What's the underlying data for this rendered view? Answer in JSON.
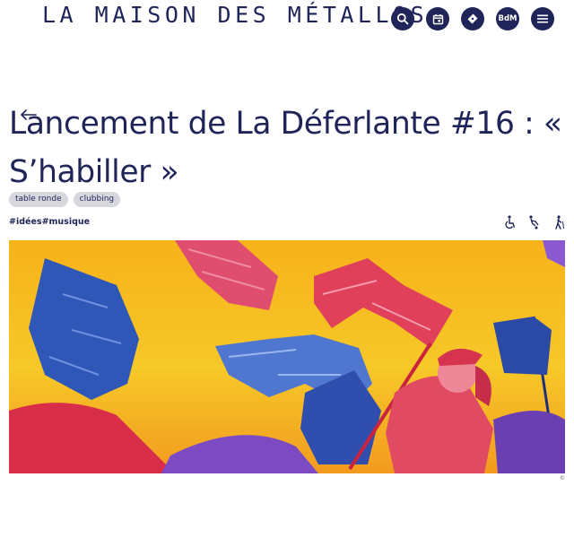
{
  "header": {
    "site_title": "LA MAISON DES MÉTALLOS",
    "icons": [
      "search-icon",
      "calendar-icon",
      "ticket-icon",
      "bdm-badge",
      "menu-icon"
    ],
    "bdm_label": "BdM"
  },
  "event": {
    "title": "Lancement de La Déferlante #16 : « S’habiller »",
    "tags": [
      "table ronde",
      "clubbing"
    ],
    "hashtags": [
      "#idées",
      "#musique"
    ],
    "accessibility_icons": [
      "wheelchair-icon",
      "mobility-icon",
      "walking-icon"
    ]
  },
  "hero_image": {
    "credit": "©"
  },
  "colors": {
    "brand_navy": "#1f2459",
    "tag_bg": "#d7d8de",
    "hero_yellow": "#f6c21c",
    "hero_red": "#e0405a",
    "hero_blue": "#2e57b8",
    "hero_violet": "#7c4bc4"
  }
}
